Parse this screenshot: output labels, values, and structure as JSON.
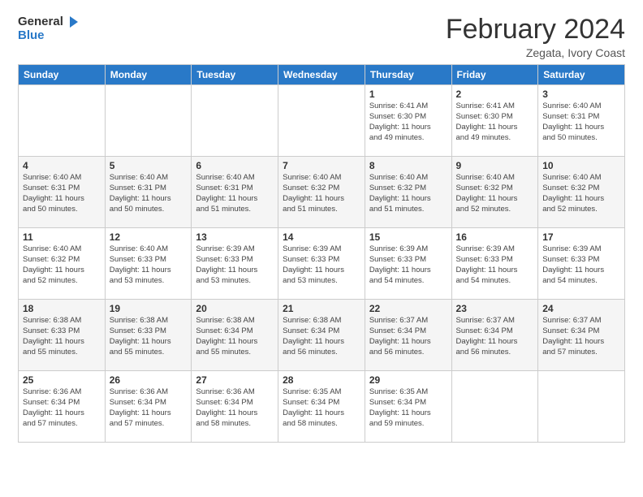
{
  "logo": {
    "general": "General",
    "blue": "Blue"
  },
  "header": {
    "month": "February 2024",
    "location": "Zegata, Ivory Coast"
  },
  "weekdays": [
    "Sunday",
    "Monday",
    "Tuesday",
    "Wednesday",
    "Thursday",
    "Friday",
    "Saturday"
  ],
  "weeks": [
    [
      {
        "day": "",
        "info": ""
      },
      {
        "day": "",
        "info": ""
      },
      {
        "day": "",
        "info": ""
      },
      {
        "day": "",
        "info": ""
      },
      {
        "day": "1",
        "info": "Sunrise: 6:41 AM\nSunset: 6:30 PM\nDaylight: 11 hours\nand 49 minutes."
      },
      {
        "day": "2",
        "info": "Sunrise: 6:41 AM\nSunset: 6:30 PM\nDaylight: 11 hours\nand 49 minutes."
      },
      {
        "day": "3",
        "info": "Sunrise: 6:40 AM\nSunset: 6:31 PM\nDaylight: 11 hours\nand 50 minutes."
      }
    ],
    [
      {
        "day": "4",
        "info": "Sunrise: 6:40 AM\nSunset: 6:31 PM\nDaylight: 11 hours\nand 50 minutes."
      },
      {
        "day": "5",
        "info": "Sunrise: 6:40 AM\nSunset: 6:31 PM\nDaylight: 11 hours\nand 50 minutes."
      },
      {
        "day": "6",
        "info": "Sunrise: 6:40 AM\nSunset: 6:31 PM\nDaylight: 11 hours\nand 51 minutes."
      },
      {
        "day": "7",
        "info": "Sunrise: 6:40 AM\nSunset: 6:32 PM\nDaylight: 11 hours\nand 51 minutes."
      },
      {
        "day": "8",
        "info": "Sunrise: 6:40 AM\nSunset: 6:32 PM\nDaylight: 11 hours\nand 51 minutes."
      },
      {
        "day": "9",
        "info": "Sunrise: 6:40 AM\nSunset: 6:32 PM\nDaylight: 11 hours\nand 52 minutes."
      },
      {
        "day": "10",
        "info": "Sunrise: 6:40 AM\nSunset: 6:32 PM\nDaylight: 11 hours\nand 52 minutes."
      }
    ],
    [
      {
        "day": "11",
        "info": "Sunrise: 6:40 AM\nSunset: 6:32 PM\nDaylight: 11 hours\nand 52 minutes."
      },
      {
        "day": "12",
        "info": "Sunrise: 6:40 AM\nSunset: 6:33 PM\nDaylight: 11 hours\nand 53 minutes."
      },
      {
        "day": "13",
        "info": "Sunrise: 6:39 AM\nSunset: 6:33 PM\nDaylight: 11 hours\nand 53 minutes."
      },
      {
        "day": "14",
        "info": "Sunrise: 6:39 AM\nSunset: 6:33 PM\nDaylight: 11 hours\nand 53 minutes."
      },
      {
        "day": "15",
        "info": "Sunrise: 6:39 AM\nSunset: 6:33 PM\nDaylight: 11 hours\nand 54 minutes."
      },
      {
        "day": "16",
        "info": "Sunrise: 6:39 AM\nSunset: 6:33 PM\nDaylight: 11 hours\nand 54 minutes."
      },
      {
        "day": "17",
        "info": "Sunrise: 6:39 AM\nSunset: 6:33 PM\nDaylight: 11 hours\nand 54 minutes."
      }
    ],
    [
      {
        "day": "18",
        "info": "Sunrise: 6:38 AM\nSunset: 6:33 PM\nDaylight: 11 hours\nand 55 minutes."
      },
      {
        "day": "19",
        "info": "Sunrise: 6:38 AM\nSunset: 6:33 PM\nDaylight: 11 hours\nand 55 minutes."
      },
      {
        "day": "20",
        "info": "Sunrise: 6:38 AM\nSunset: 6:34 PM\nDaylight: 11 hours\nand 55 minutes."
      },
      {
        "day": "21",
        "info": "Sunrise: 6:38 AM\nSunset: 6:34 PM\nDaylight: 11 hours\nand 56 minutes."
      },
      {
        "day": "22",
        "info": "Sunrise: 6:37 AM\nSunset: 6:34 PM\nDaylight: 11 hours\nand 56 minutes."
      },
      {
        "day": "23",
        "info": "Sunrise: 6:37 AM\nSunset: 6:34 PM\nDaylight: 11 hours\nand 56 minutes."
      },
      {
        "day": "24",
        "info": "Sunrise: 6:37 AM\nSunset: 6:34 PM\nDaylight: 11 hours\nand 57 minutes."
      }
    ],
    [
      {
        "day": "25",
        "info": "Sunrise: 6:36 AM\nSunset: 6:34 PM\nDaylight: 11 hours\nand 57 minutes."
      },
      {
        "day": "26",
        "info": "Sunrise: 6:36 AM\nSunset: 6:34 PM\nDaylight: 11 hours\nand 57 minutes."
      },
      {
        "day": "27",
        "info": "Sunrise: 6:36 AM\nSunset: 6:34 PM\nDaylight: 11 hours\nand 58 minutes."
      },
      {
        "day": "28",
        "info": "Sunrise: 6:35 AM\nSunset: 6:34 PM\nDaylight: 11 hours\nand 58 minutes."
      },
      {
        "day": "29",
        "info": "Sunrise: 6:35 AM\nSunset: 6:34 PM\nDaylight: 11 hours\nand 59 minutes."
      },
      {
        "day": "",
        "info": ""
      },
      {
        "day": "",
        "info": ""
      }
    ]
  ]
}
